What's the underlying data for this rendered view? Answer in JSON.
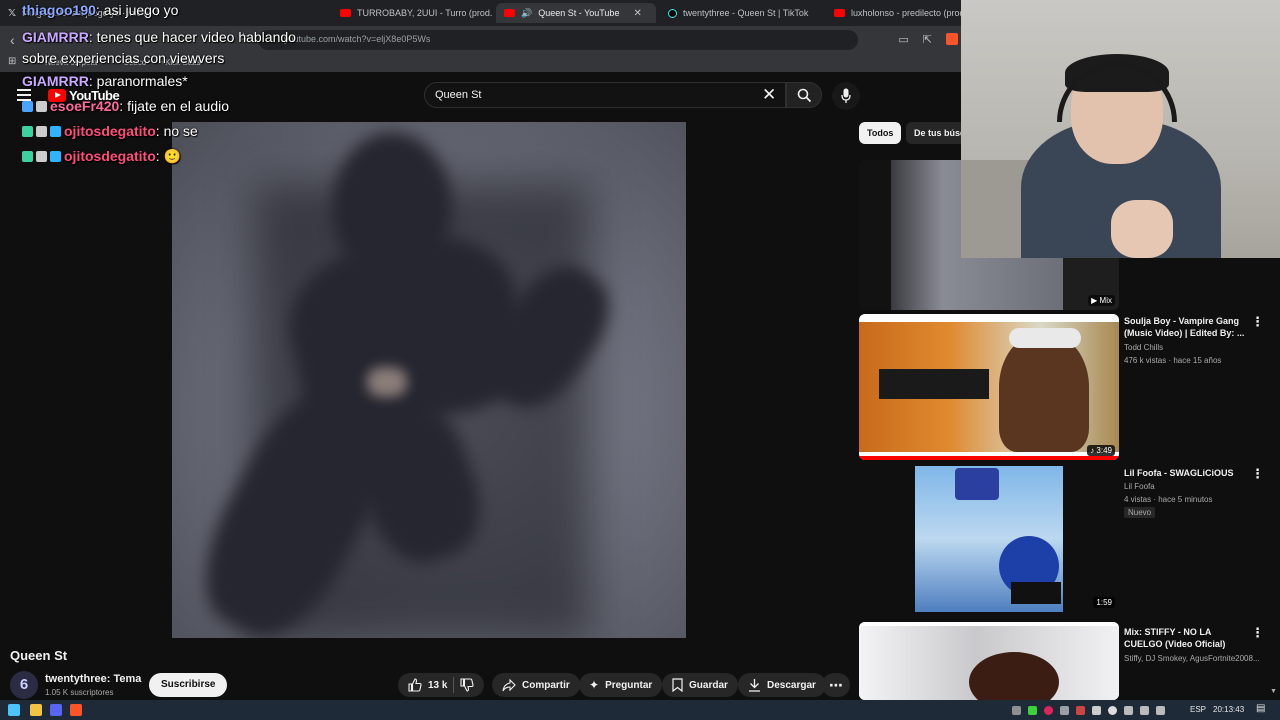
{
  "browser": {
    "tabs": [
      {
        "label": "thiagoo190: asi juego yo · inicio / X",
        "type": "x"
      },
      {
        "label": "TURROBABY, 2UUI - Turro (prod. Tul",
        "type": "youtube"
      },
      {
        "label": "Queen St - YouTube",
        "type": "youtube",
        "active": true
      },
      {
        "label": "twentythree - Queen St | TikTok",
        "type": "tiktok"
      },
      {
        "label": "luxholonso - predilecto (prod. el",
        "type": "youtube"
      }
    ],
    "url": "youtube.com/watch?v=eljX8e0P5Ws",
    "bookmarks": [
      "Nueva carpeta",
      "Osaco",
      "Kick Stats"
    ]
  },
  "youtube": {
    "logo_text": "YouTube",
    "search_value": "Queen St",
    "video_title": "Queen St",
    "channel_name": "twentythree: Tema",
    "subscribers": "1.05 K suscriptores",
    "subscribe_label": "Suscribirse",
    "likes": "13 k",
    "share_label": "Compartir",
    "ask_label": "Preguntar",
    "save_label": "Guardar",
    "download_label": "Descargar",
    "chips": [
      "Todos",
      "De tus búsq"
    ],
    "recommendations": [
      {
        "title": "",
        "channel": "",
        "meta": "",
        "badge": "Mix"
      },
      {
        "title": "Soulja Boy - Vampire Gang (Music Video) | Edited By: ...",
        "channel": "Todd Chills",
        "meta": "476 k vistas · hace 15 años",
        "duration": "3:49"
      },
      {
        "title": "Lil Foofa - SWAGLiCiOUS",
        "channel": "Lil Foofa",
        "meta": "4 vistas · hace 5 minutos",
        "duration": "1:59",
        "badge": "Nuevo"
      },
      {
        "title": "Mix: STIFFY - NO LA CUELGO (Video Oficial)",
        "channel": "Stiffy, DJ Smokey, AgusFortnite2008...",
        "meta": ""
      }
    ]
  },
  "chat": [
    {
      "user": "thiagoo190",
      "message": "asi juego yo",
      "color": "#8aa8ff"
    },
    {
      "user": "GIAMRRR",
      "message": "tenes que hacer video hablando sobre experiencias con viewvers",
      "color": "#c9a8ff"
    },
    {
      "user": "GIAMRRR",
      "message": "paranormales*",
      "color": "#c9a8ff"
    },
    {
      "user": "esoeFr420",
      "message": "fijate en el audio",
      "color": "#ff6b9a"
    },
    {
      "user": "ojitosdegatito",
      "message": "no se",
      "color": "#ff4d7a"
    },
    {
      "user": "ojitosdegatito",
      "message": "🙂",
      "color": "#ff4d7a"
    }
  ],
  "taskbar": {
    "language": "ESP",
    "time": "20:13:43"
  }
}
